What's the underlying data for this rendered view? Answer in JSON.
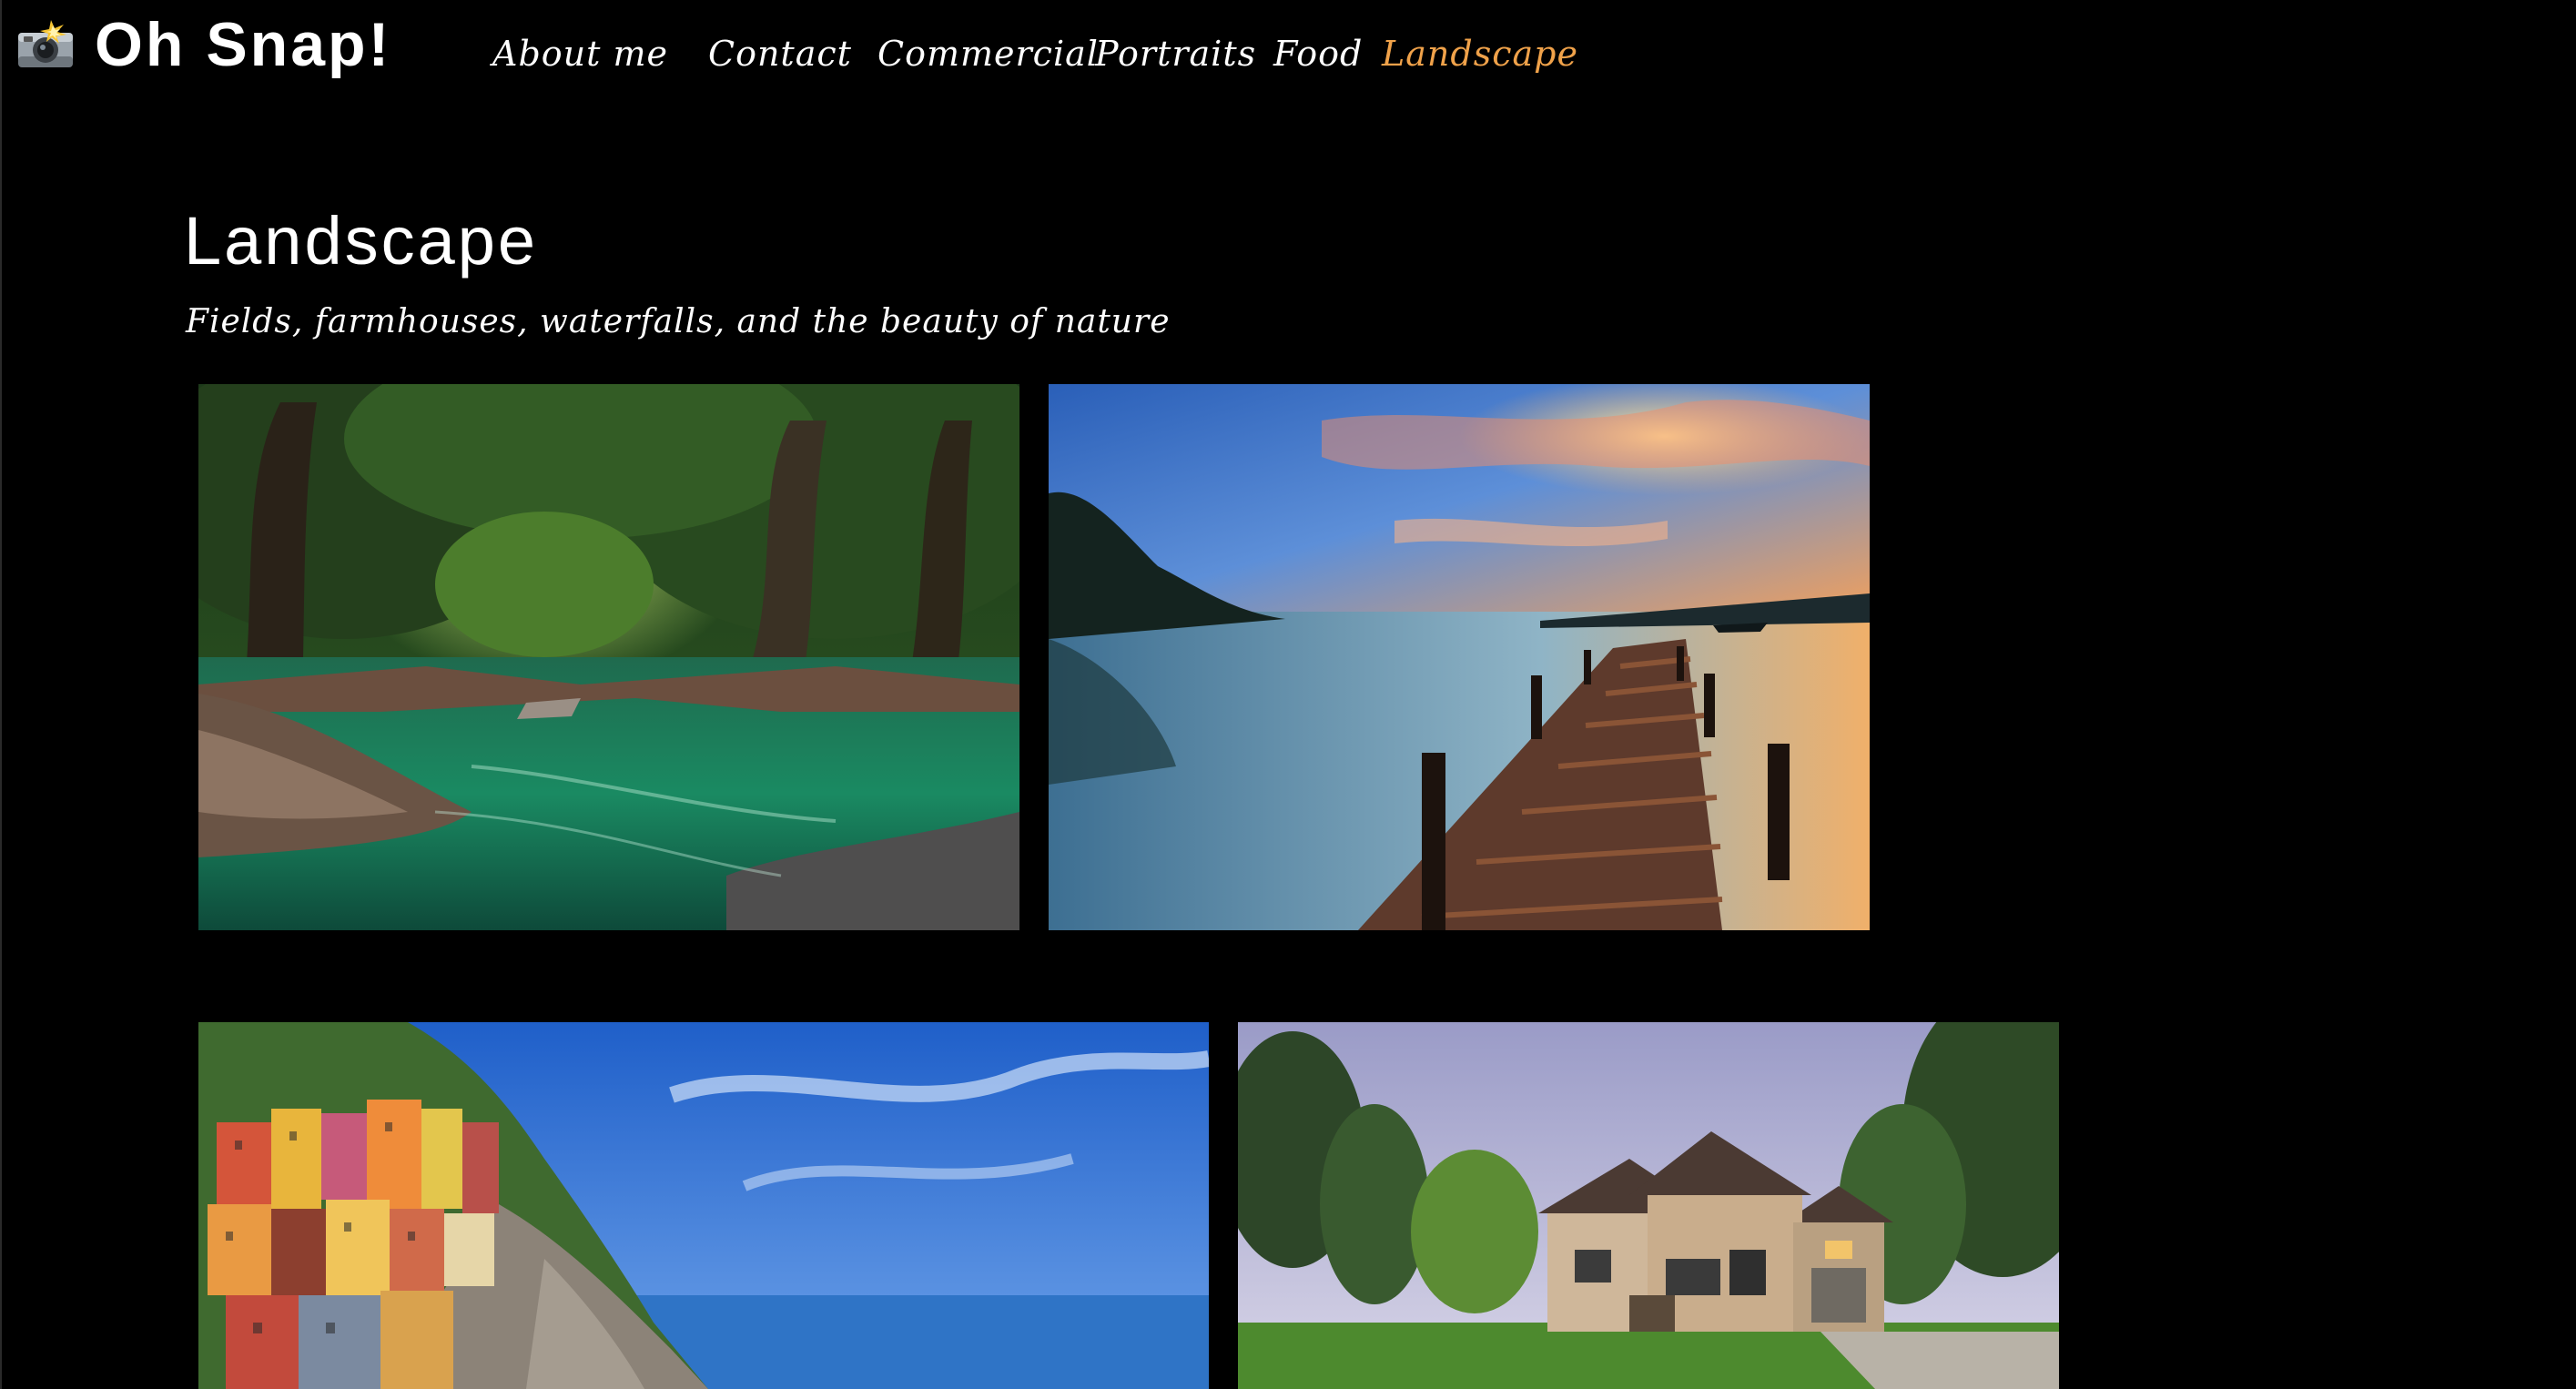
{
  "site": {
    "name": "Oh Snap!",
    "logo_icon": "camera-flash-icon"
  },
  "nav": {
    "items": [
      {
        "label": "About me"
      },
      {
        "label": "Contact"
      },
      {
        "label": "Commercial"
      },
      {
        "label": "Portraits"
      },
      {
        "label": "Food"
      },
      {
        "label": "Landscape",
        "active": true
      }
    ],
    "active_color": "#f0a24a"
  },
  "page": {
    "title": "Landscape",
    "subtitle": "Fields, farmhouses, waterfalls, and the beauty of nature"
  },
  "gallery": [
    {
      "subject": "forest-river"
    },
    {
      "subject": "lake-pier-sunset"
    },
    {
      "subject": "coastal-village-cliff"
    },
    {
      "subject": "stone-house"
    }
  ]
}
